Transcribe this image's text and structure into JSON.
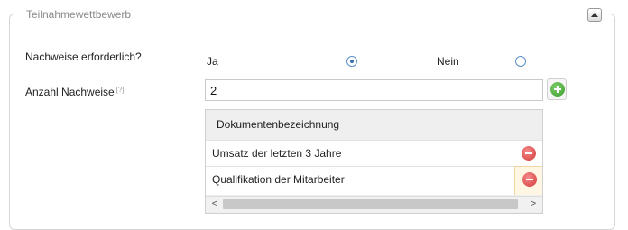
{
  "fieldset": {
    "legend": "Teilnahmewettbewerb"
  },
  "nachweise": {
    "label": "Nachweise erforderlich?",
    "options": [
      {
        "label": "Ja",
        "checked": true
      },
      {
        "label": "Nein",
        "checked": false
      }
    ]
  },
  "anzahl": {
    "label": "Anzahl Nachweise",
    "help": "[?]",
    "value": "2"
  },
  "documents": {
    "header": "Dokumentenbezeichnung",
    "rows": [
      {
        "name": "Umsatz der letzten 3 Jahre"
      },
      {
        "name": "Qualifikation der Mitarbeiter"
      }
    ]
  },
  "scrollbar": {
    "left_arrow": "<",
    "right_arrow": ">"
  },
  "colors": {
    "add": "#3a9a2a",
    "remove": "#d33a3a",
    "radio": "#5b8ec9"
  },
  "icons": {
    "collapse": "collapse-up-icon",
    "add": "add-circle-icon",
    "remove": "remove-circle-icon"
  }
}
